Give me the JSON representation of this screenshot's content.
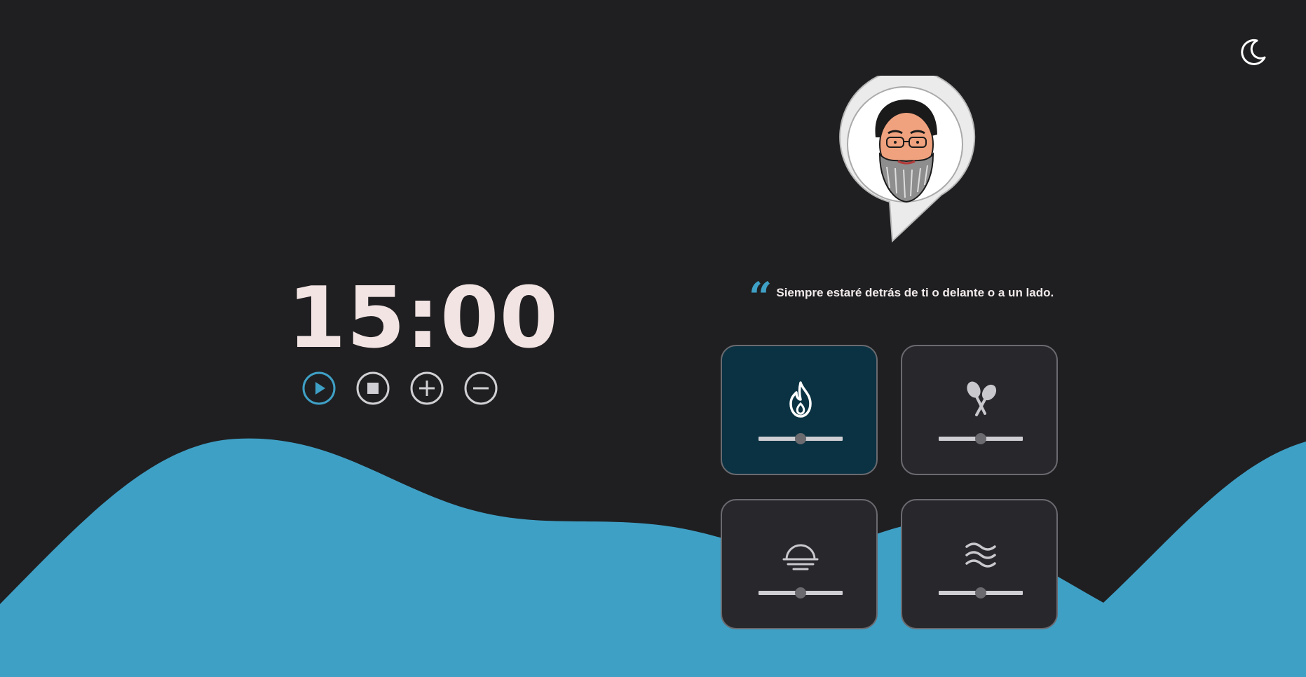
{
  "timer": {
    "display": "15:00"
  },
  "controls": {
    "accent_color": "#3fa0c6",
    "neutral_color": "#d0d0d4",
    "buttons": [
      {
        "icon": "play-icon",
        "state": "active"
      },
      {
        "icon": "stop-icon",
        "state": "idle"
      },
      {
        "icon": "plus-icon",
        "state": "idle"
      },
      {
        "icon": "minus-icon",
        "state": "idle"
      }
    ]
  },
  "header": {
    "theme_icon": "moon-icon"
  },
  "quote": {
    "mark": "“",
    "text": "Siempre estaré detrás de ti o delante o a un lado."
  },
  "avatar": {
    "icon": "speech-bubble-avatar"
  },
  "sounds": [
    {
      "icon": "fire-icon",
      "active": true,
      "volume": 0.5
    },
    {
      "icon": "maracas-icon",
      "active": false,
      "volume": 0.5
    },
    {
      "icon": "sunset-icon",
      "active": false,
      "volume": 0.5
    },
    {
      "icon": "waves-icon",
      "active": false,
      "volume": 0.5
    }
  ],
  "colors": {
    "background": "#1f1f21",
    "wave": "#3fa0c6",
    "text": "#f3e4e4",
    "card": "#28282c",
    "card_active": "#0a3242"
  }
}
